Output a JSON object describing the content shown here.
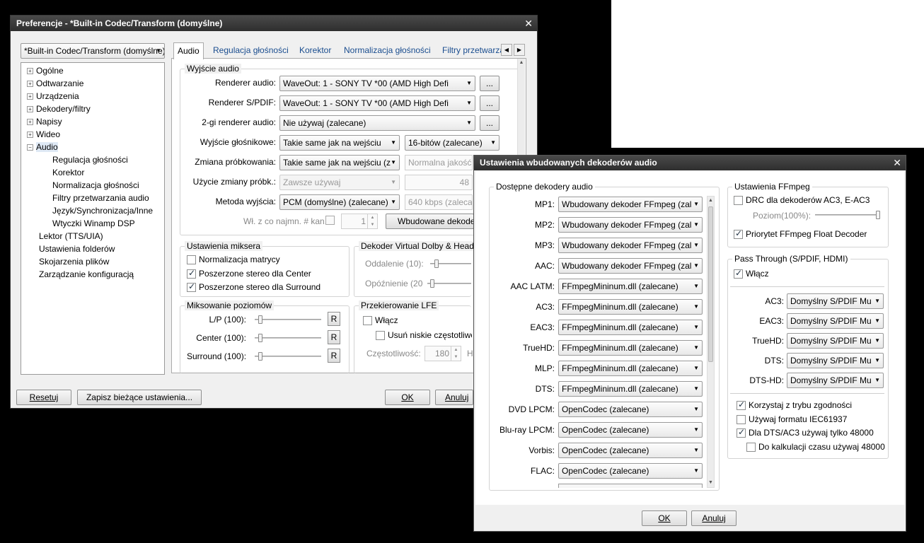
{
  "pref": {
    "title": "Preferencje - *Built-in Codec/Transform (domyślne)",
    "profile": "*Built-in Codec/Transform (domyślne)",
    "tree": [
      {
        "label": "Ogólne"
      },
      {
        "label": "Odtwarzanie"
      },
      {
        "label": "Urządzenia"
      },
      {
        "label": "Dekodery/filtry"
      },
      {
        "label": "Napisy"
      },
      {
        "label": "Wideo"
      },
      {
        "label": "Audio"
      },
      {
        "label": "Regulacja głośności"
      },
      {
        "label": "Korektor"
      },
      {
        "label": "Normalizacja głośności"
      },
      {
        "label": "Filtry przetwarzania audio"
      },
      {
        "label": "Język/Synchronizacja/Inne"
      },
      {
        "label": "Wtyczki Winamp DSP"
      },
      {
        "label": "Lektor (TTS/UIA)"
      },
      {
        "label": "Ustawienia folderów"
      },
      {
        "label": "Skojarzenia plików"
      },
      {
        "label": "Zarządzanie konfiguracją"
      }
    ],
    "tabs": [
      "Audio",
      "Regulacja głośności",
      "Korektor",
      "Normalizacja głośności",
      "Filtry przetwarzania"
    ],
    "output": {
      "caption": "Wyjście audio",
      "renderer_label": "Renderer audio:",
      "renderer_value": "WaveOut: 1 - SONY TV  *00 (AMD High Defi",
      "spdif_label": "Renderer S/PDIF:",
      "spdif_value": "WaveOut: 1 - SONY TV  *00 (AMD High Defi",
      "second_label": "2-gi renderer audio:",
      "second_value": "Nie używaj (zalecane)",
      "dots": "...",
      "speaker_label": "Wyjście głośnikowe:",
      "speaker_value": "Takie same jak na wejściu",
      "bits_value": "16-bitów (zalecane)",
      "resample_label": "Zmiana próbkowania:",
      "resample_value": "Takie same jak na wejściu (z",
      "quality_value": "Normalna jakość",
      "use_resample_label": "Użycie zmiany próbk.:",
      "use_resample_value": "Zawsze używaj",
      "use_resample_num": "48",
      "method_label": "Metoda wyjścia:",
      "method_value": "PCM (domyślne) (zalecane)",
      "bitrate_value": "640 kbps (zalecan",
      "minch_label": "Wł. z co najmn. # kan.",
      "minch_value": "1",
      "builtin_btn": "Wbudowane dekode"
    },
    "mixer": {
      "caption": "Ustawienia miksera",
      "items": [
        {
          "label": "Normalizacja matrycy",
          "checked": false
        },
        {
          "label": "Poszerzone stereo dla Center",
          "checked": true
        },
        {
          "label": "Poszerzone stereo dla Surround",
          "checked": true
        }
      ]
    },
    "vdolby": {
      "caption": "Dekoder Virtual Dolby & Head",
      "dist_label": "Oddalenie (10):",
      "delay_label": "Opóźnienie (20"
    },
    "levels": {
      "caption": "Miksowanie poziomów",
      "rows": [
        {
          "label": "L/P (100):",
          "btn": "R",
          "level": 0.06
        },
        {
          "label": "Center (100):",
          "btn": "R",
          "level": 0.06
        },
        {
          "label": "Surround (100):",
          "btn": "R",
          "level": 0.06
        }
      ]
    },
    "lfe": {
      "caption": "Przekierowanie LFE",
      "enable": "Włącz",
      "remove_low": "Usuń niskie częstotliwo",
      "freq_label": "Częstotliwość:",
      "freq_value": "180",
      "freq_unit": "H"
    },
    "buttons": {
      "reset": "Resetuj",
      "save": "Zapisz bieżące ustawienia...",
      "ok": "OK",
      "cancel": "Anuluj"
    }
  },
  "dec": {
    "title": "Ustawienia wbudowanych dekoderów audio",
    "avail_caption": "Dostępne dekodery audio",
    "decoders": [
      {
        "label": "MP1:",
        "value": "Wbudowany dekoder FFmpeg (zal"
      },
      {
        "label": "MP2:",
        "value": "Wbudowany dekoder FFmpeg (zal"
      },
      {
        "label": "MP3:",
        "value": "Wbudowany dekoder FFmpeg (zal"
      },
      {
        "label": "AAC:",
        "value": "Wbudowany dekoder FFmpeg (zal"
      },
      {
        "label": "AAC LATM:",
        "value": "FFmpegMininum.dll (zalecane)"
      },
      {
        "label": "AC3:",
        "value": "FFmpegMininum.dll (zalecane)"
      },
      {
        "label": "EAC3:",
        "value": "FFmpegMininum.dll (zalecane)"
      },
      {
        "label": "TrueHD:",
        "value": "FFmpegMininum.dll (zalecane)"
      },
      {
        "label": "MLP:",
        "value": "FFmpegMininum.dll (zalecane)"
      },
      {
        "label": "DTS:",
        "value": "FFmpegMininum.dll (zalecane)"
      },
      {
        "label": "DVD LPCM:",
        "value": "OpenCodec (zalecane)"
      },
      {
        "label": "Blu-ray LPCM:",
        "value": "OpenCodec (zalecane)"
      },
      {
        "label": "Vorbis:",
        "value": "OpenCodec (zalecane)"
      },
      {
        "label": "FLAC:",
        "value": "OpenCodec (zalecane)"
      }
    ],
    "ffmpeg": {
      "caption": "Ustawienia FFmpeg",
      "drc": "DRC dla dekoderów AC3, E-AC3",
      "level_label": "Poziom(100%):",
      "float": "Priorytet FFmpeg Float Decoder"
    },
    "pass": {
      "caption": "Pass Through (S/PDIF, HDMI)",
      "enable": "Włącz",
      "rows": [
        {
          "label": "AC3:",
          "value": "Domyślny S/PDIF Mu"
        },
        {
          "label": "EAC3:",
          "value": "Domyślny S/PDIF Mu"
        },
        {
          "label": "TrueHD:",
          "value": "Domyślny S/PDIF Mu"
        },
        {
          "label": "DTS:",
          "value": "Domyślny S/PDIF Mu"
        },
        {
          "label": "DTS-HD:",
          "value": "Domyślny S/PDIF Mu"
        }
      ],
      "compat": "Korzystaj z trybu zgodności",
      "iec": "Używaj formatu IEC61937",
      "dts48": "Dla DTS/AC3 używaj tylko 48000",
      "calc48": "Do kalkulacji czasu używaj 48000"
    },
    "buttons": {
      "ok": "OK",
      "cancel": "Anuluj"
    }
  }
}
